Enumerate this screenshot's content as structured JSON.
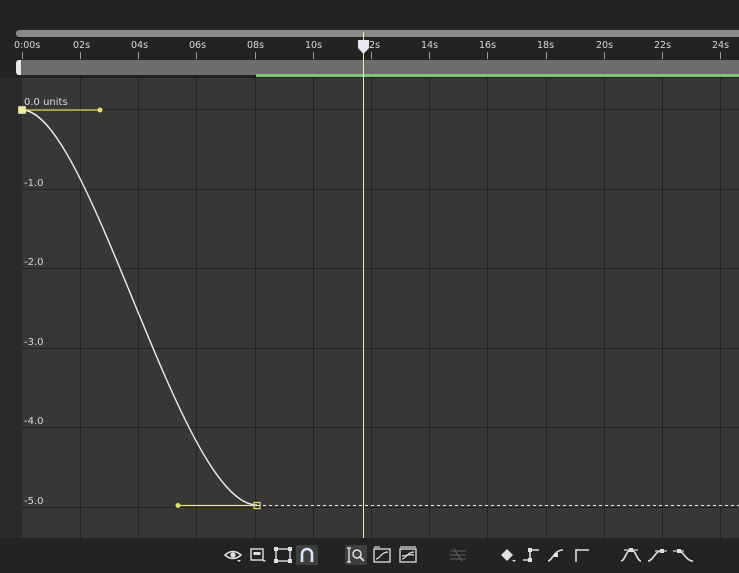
{
  "timeline": {
    "ruler_ticks": [
      "0:00s",
      "02s",
      "04s",
      "06s",
      "08s",
      "10s",
      "12s",
      "14s",
      "16s",
      "18s",
      "20s",
      "22s",
      "24s"
    ]
  },
  "graph": {
    "value_labels": [
      "0.0 units",
      "-1.0",
      "-2.0",
      "-3.0",
      "-4.0",
      "-5.0"
    ]
  },
  "keyframes": [
    {
      "time_s": 0,
      "value": 0.0
    },
    {
      "time_s": 8,
      "value": -5.0
    }
  ],
  "current_time_s": 11.7,
  "colors": {
    "graph_bg": "#383735",
    "grid_line": "#232323",
    "curve": "#ececec",
    "keyframe_handle": "#e6de6b",
    "cti": "#e7f3a5",
    "work_area_bar": "#7dc77d"
  },
  "toolbar": {
    "icons": [
      "show-properties-icon",
      "graph-type-options-icon",
      "transform-box-icon",
      "snap-icon",
      "auto-zoom-height-icon",
      "fit-selection-icon",
      "fit-all-icon",
      "separate-dimensions-icon",
      "edit-keyframe-icon",
      "convert-hold-icon",
      "convert-auto-bezier-icon",
      "convert-linear-icon",
      "easy-ease-icon",
      "easy-ease-in-icon",
      "easy-ease-out-icon"
    ]
  }
}
